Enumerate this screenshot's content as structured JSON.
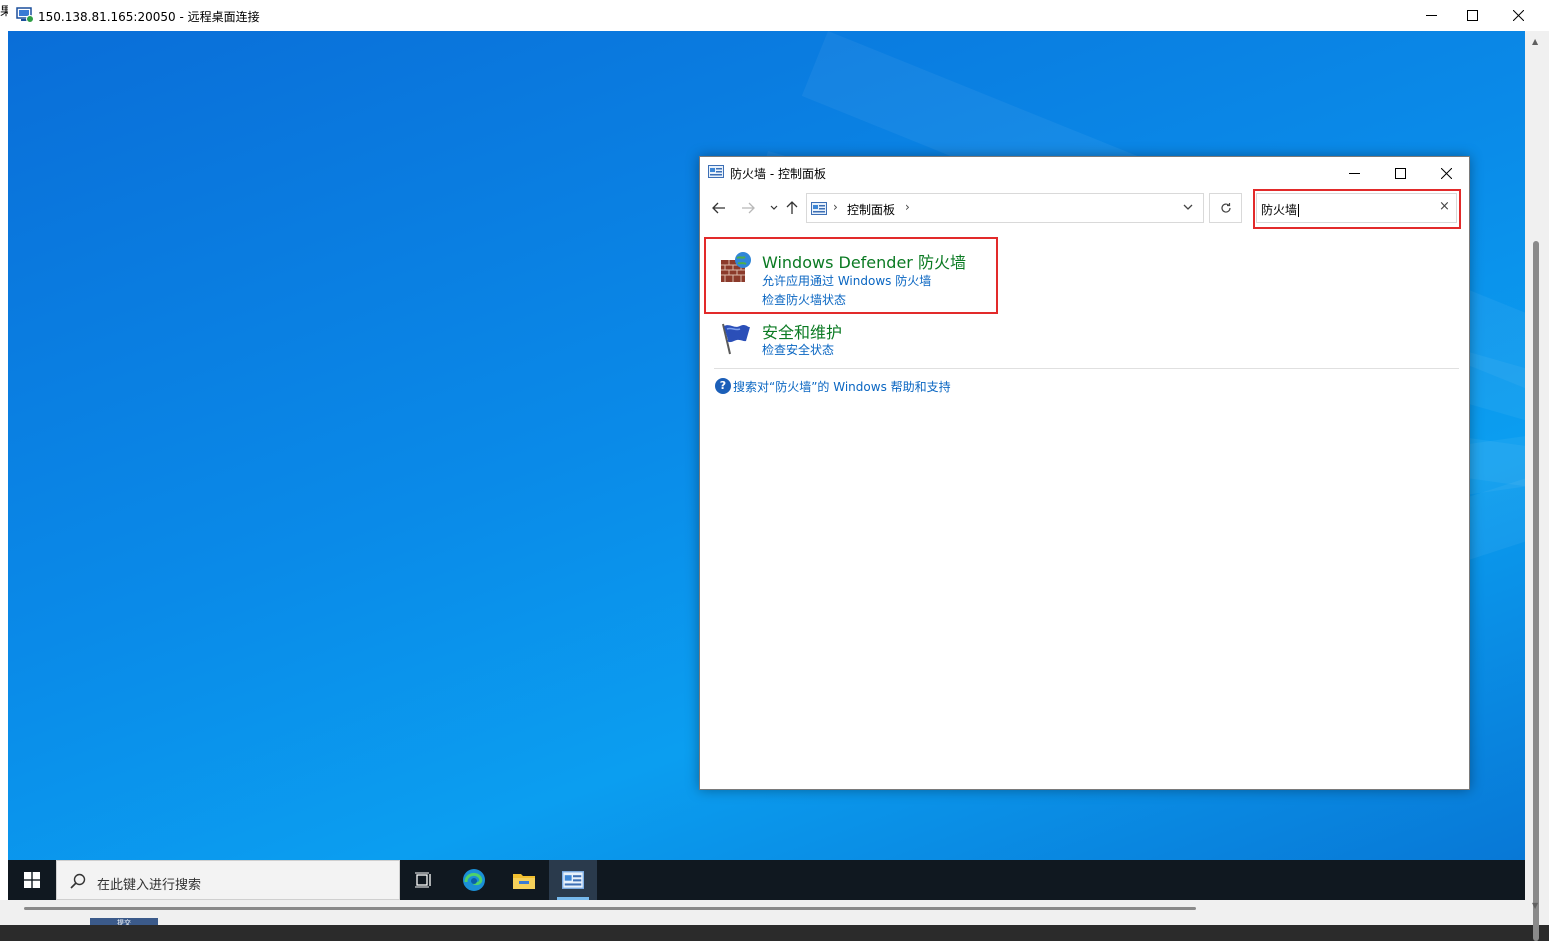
{
  "rdp": {
    "title": "150.138.81.165:20050 - 远程桌面连接",
    "left_edge_text": "果",
    "hscroll_peek": "提交"
  },
  "control_panel": {
    "title": "防火墙 - 控制面板",
    "address": {
      "crumb": "控制面板"
    },
    "search": {
      "value": "防火墙",
      "clear_glyph": "×"
    },
    "results": [
      {
        "title": "Windows Defender 防火墙",
        "links": [
          "允许应用通过 Windows 防火墙",
          "检查防火墙状态"
        ],
        "icon": "firewall-icon"
      },
      {
        "title": "安全和维护",
        "links": [
          "检查安全状态"
        ],
        "icon": "security-flag-icon"
      }
    ],
    "help_link": "搜索对“防火墙”的 Windows 帮助和支持"
  },
  "taskbar": {
    "search_placeholder": "在此键入进行搜索",
    "items": [
      "task-view-icon",
      "edge-icon",
      "file-explorer-icon",
      "control-panel-icon"
    ]
  },
  "colors": {
    "highlight": "#e22a2a",
    "result_title": "#0a7a22",
    "link": "#0a66c2",
    "desktop": "#0a8ae8",
    "taskbar": "#101820"
  }
}
